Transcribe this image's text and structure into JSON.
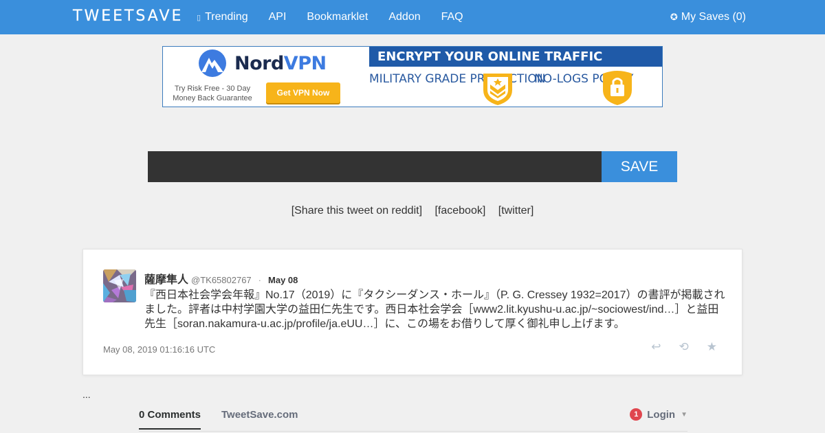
{
  "nav": {
    "brand": "TWEETSAVE",
    "links": [
      {
        "label": "Trending",
        "icon": "fire-icon",
        "glyph": "▯"
      },
      {
        "label": "API"
      },
      {
        "label": "Bookmarklet"
      },
      {
        "label": "Addon"
      },
      {
        "label": "FAQ"
      }
    ],
    "my_saves": "My Saves (0)",
    "my_saves_icon": "✪"
  },
  "ad": {
    "brand_main": "Nord",
    "brand_accent": "VPN",
    "risk_text": "Try Risk Free - 30 Day Money Back Guarantee",
    "button": "Get VPN Now",
    "banner": "ENCRYPT YOUR ONLINE TRAFFIC",
    "feature1": "MILITARY GRADE PROTECTION",
    "feature2": "NO-LOGS POLICY",
    "colors": {
      "navy": "#1f5aa8",
      "gold": "#f7b41a"
    }
  },
  "save": {
    "input_value": "",
    "button": "SAVE"
  },
  "share": {
    "reddit": "[Share this tweet on reddit]",
    "facebook": "[facebook]",
    "twitter": "[twitter]"
  },
  "tweet": {
    "name": "薩摩隼人",
    "handle": "@TK65802767",
    "separator": "·",
    "date": "May 08",
    "text": "『西日本社会学会年報』No.17（2019）に『タクシーダンス・ホール』（P. G. Cressey 1932=2017）の書評が掲載されました。評者は中村学園大学の益田仁先生です。西日本社会学会［www2.lit.kyushu-u.ac.jp/~sociowest/ind…］と益田先生［soran.nakamura-u.ac.jp/profile/ja.eUU…］に、この場をお借りして厚く御礼申し上げます。",
    "timestamp": "May 08, 2019 01:16:16 UTC",
    "actions": [
      {
        "name": "reply-icon",
        "glyph": "↩"
      },
      {
        "name": "retweet-icon",
        "glyph": "⟲"
      },
      {
        "name": "favorite-icon",
        "glyph": "★"
      }
    ]
  },
  "ellipsis": "...",
  "comments": {
    "count_tab": "0 Comments",
    "site_tab": "TweetSave.com",
    "badge": "1",
    "login": "Login",
    "caret": "▼"
  },
  "colors": {
    "primary": "#3a8fdc",
    "input_bg": "#333333"
  }
}
